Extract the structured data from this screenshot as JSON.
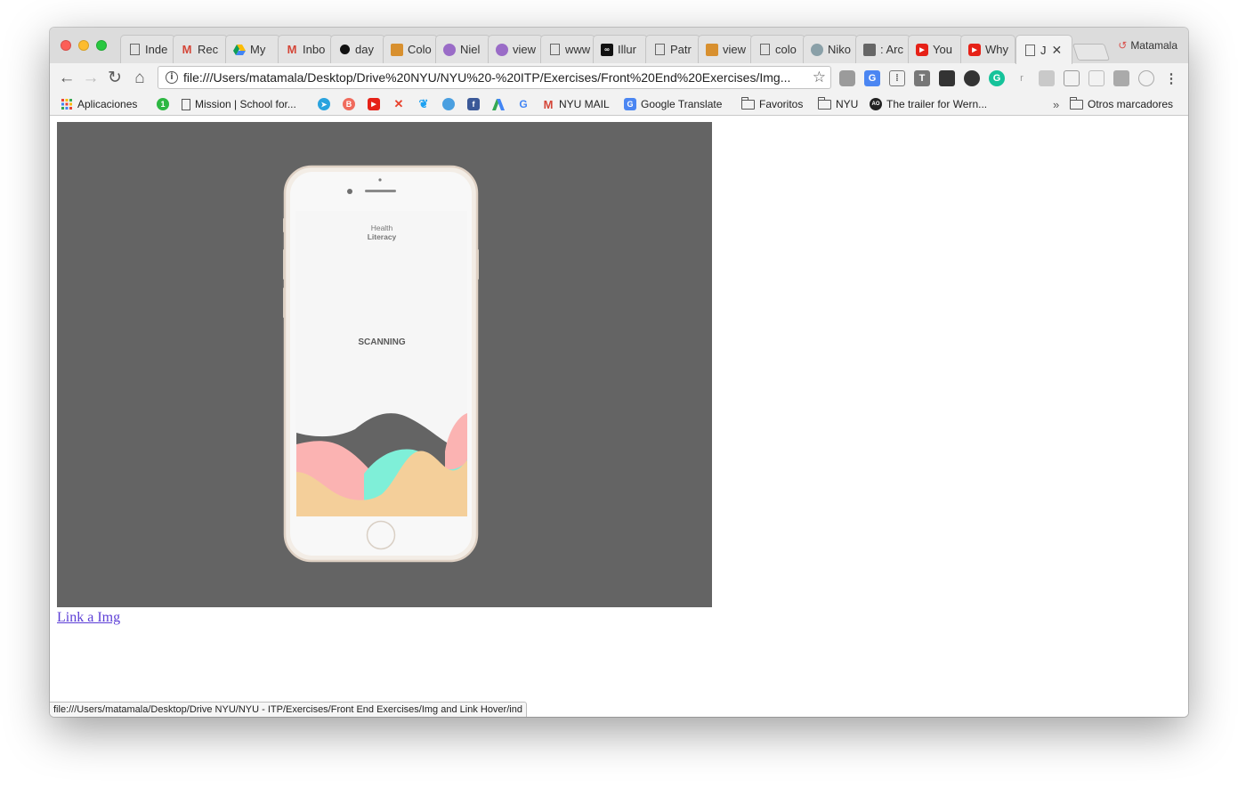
{
  "profile": {
    "name": "Matamala"
  },
  "tabs": [
    {
      "label": "Inde",
      "icon": "page-icon"
    },
    {
      "label": "Rec",
      "icon": "gmail-icon"
    },
    {
      "label": "My",
      "icon": "drive-icon"
    },
    {
      "label": "Inbo",
      "icon": "gmail-icon"
    },
    {
      "label": "day",
      "icon": "bomb-icon"
    },
    {
      "label": "Colo",
      "icon": "image-icon"
    },
    {
      "label": "Niel",
      "icon": "avatar-icon"
    },
    {
      "label": "view",
      "icon": "avatar-icon"
    },
    {
      "label": "www",
      "icon": "page-icon"
    },
    {
      "label": "Illur",
      "icon": "illustration-icon"
    },
    {
      "label": "Patr",
      "icon": "page-icon"
    },
    {
      "label": "view",
      "icon": "image-icon"
    },
    {
      "label": "colo",
      "icon": "page-icon"
    },
    {
      "label": "Niko",
      "icon": "globe-icon"
    },
    {
      "label": ": Arc",
      "icon": "square-icon"
    },
    {
      "label": "You",
      "icon": "youtube-icon"
    },
    {
      "label": "Why",
      "icon": "youtube-icon"
    },
    {
      "label": "J",
      "icon": "page-icon",
      "active": true
    }
  ],
  "toolbar": {
    "url": "file:///Users/matamala/Desktop/Drive%20NYU/NYU%20-%20ITP/Exercises/Front%20End%20Exercises/Img..."
  },
  "bookmarks": [
    {
      "label": "Aplicaciones",
      "icon": "apps-grid-icon"
    },
    {
      "label": "",
      "icon": "green-circle-1-icon"
    },
    {
      "label": "Mission | School for...",
      "icon": "page-icon"
    },
    {
      "label": "",
      "icon": "telegram-icon"
    },
    {
      "label": "",
      "icon": "behance-icon"
    },
    {
      "label": "",
      "icon": "youtube-icon"
    },
    {
      "label": "",
      "icon": "x-color-icon"
    },
    {
      "label": "",
      "icon": "twitter-icon"
    },
    {
      "label": "",
      "icon": "swirl-icon"
    },
    {
      "label": "",
      "icon": "facebook-icon"
    },
    {
      "label": "",
      "icon": "adwords-icon"
    },
    {
      "label": "",
      "icon": "google-icon"
    },
    {
      "label": "NYU MAIL",
      "icon": "gmail-icon"
    },
    {
      "label": "Google Translate",
      "icon": "translate-icon"
    },
    {
      "label": "Favoritos",
      "icon": "folder-icon"
    },
    {
      "label": "NYU",
      "icon": "folder-icon"
    },
    {
      "label": "The trailer for Wern...",
      "icon": "atlas-icon"
    }
  ],
  "bookmarks_overflow": {
    "label": "»"
  },
  "other_bookmarks": {
    "label": "Otros marcadores"
  },
  "page": {
    "image_title": "Health Literacy",
    "image_title_line1": "Health",
    "image_title_line2": "Literacy",
    "image_status": "SCANNING",
    "link_text": "Link a Img"
  },
  "status_bar": {
    "text": "file:///Users/matamala/Desktop/Drive NYU/NYU - ITP/Exercises/Front End Exercises/Img and Link Hover/ind"
  },
  "colors": {
    "image_background": "#646464",
    "wave_pink": "#fbb3b2",
    "wave_mint": "#7fefd8",
    "wave_peach": "#f4cf9a",
    "wave_gray": "#646464",
    "link": "#5b3dd6"
  }
}
